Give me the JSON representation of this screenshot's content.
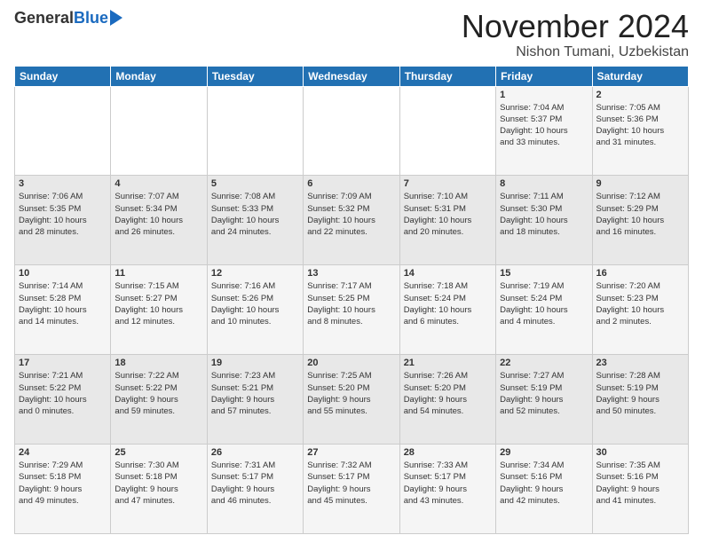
{
  "header": {
    "logo_general": "General",
    "logo_blue": "Blue",
    "month": "November 2024",
    "location": "Nishon Tumani, Uzbekistan"
  },
  "weekdays": [
    "Sunday",
    "Monday",
    "Tuesday",
    "Wednesday",
    "Thursday",
    "Friday",
    "Saturday"
  ],
  "weeks": [
    [
      {
        "day": "",
        "info": ""
      },
      {
        "day": "",
        "info": ""
      },
      {
        "day": "",
        "info": ""
      },
      {
        "day": "",
        "info": ""
      },
      {
        "day": "",
        "info": ""
      },
      {
        "day": "1",
        "info": "Sunrise: 7:04 AM\nSunset: 5:37 PM\nDaylight: 10 hours\nand 33 minutes."
      },
      {
        "day": "2",
        "info": "Sunrise: 7:05 AM\nSunset: 5:36 PM\nDaylight: 10 hours\nand 31 minutes."
      }
    ],
    [
      {
        "day": "3",
        "info": "Sunrise: 7:06 AM\nSunset: 5:35 PM\nDaylight: 10 hours\nand 28 minutes."
      },
      {
        "day": "4",
        "info": "Sunrise: 7:07 AM\nSunset: 5:34 PM\nDaylight: 10 hours\nand 26 minutes."
      },
      {
        "day": "5",
        "info": "Sunrise: 7:08 AM\nSunset: 5:33 PM\nDaylight: 10 hours\nand 24 minutes."
      },
      {
        "day": "6",
        "info": "Sunrise: 7:09 AM\nSunset: 5:32 PM\nDaylight: 10 hours\nand 22 minutes."
      },
      {
        "day": "7",
        "info": "Sunrise: 7:10 AM\nSunset: 5:31 PM\nDaylight: 10 hours\nand 20 minutes."
      },
      {
        "day": "8",
        "info": "Sunrise: 7:11 AM\nSunset: 5:30 PM\nDaylight: 10 hours\nand 18 minutes."
      },
      {
        "day": "9",
        "info": "Sunrise: 7:12 AM\nSunset: 5:29 PM\nDaylight: 10 hours\nand 16 minutes."
      }
    ],
    [
      {
        "day": "10",
        "info": "Sunrise: 7:14 AM\nSunset: 5:28 PM\nDaylight: 10 hours\nand 14 minutes."
      },
      {
        "day": "11",
        "info": "Sunrise: 7:15 AM\nSunset: 5:27 PM\nDaylight: 10 hours\nand 12 minutes."
      },
      {
        "day": "12",
        "info": "Sunrise: 7:16 AM\nSunset: 5:26 PM\nDaylight: 10 hours\nand 10 minutes."
      },
      {
        "day": "13",
        "info": "Sunrise: 7:17 AM\nSunset: 5:25 PM\nDaylight: 10 hours\nand 8 minutes."
      },
      {
        "day": "14",
        "info": "Sunrise: 7:18 AM\nSunset: 5:24 PM\nDaylight: 10 hours\nand 6 minutes."
      },
      {
        "day": "15",
        "info": "Sunrise: 7:19 AM\nSunset: 5:24 PM\nDaylight: 10 hours\nand 4 minutes."
      },
      {
        "day": "16",
        "info": "Sunrise: 7:20 AM\nSunset: 5:23 PM\nDaylight: 10 hours\nand 2 minutes."
      }
    ],
    [
      {
        "day": "17",
        "info": "Sunrise: 7:21 AM\nSunset: 5:22 PM\nDaylight: 10 hours\nand 0 minutes."
      },
      {
        "day": "18",
        "info": "Sunrise: 7:22 AM\nSunset: 5:22 PM\nDaylight: 9 hours\nand 59 minutes."
      },
      {
        "day": "19",
        "info": "Sunrise: 7:23 AM\nSunset: 5:21 PM\nDaylight: 9 hours\nand 57 minutes."
      },
      {
        "day": "20",
        "info": "Sunrise: 7:25 AM\nSunset: 5:20 PM\nDaylight: 9 hours\nand 55 minutes."
      },
      {
        "day": "21",
        "info": "Sunrise: 7:26 AM\nSunset: 5:20 PM\nDaylight: 9 hours\nand 54 minutes."
      },
      {
        "day": "22",
        "info": "Sunrise: 7:27 AM\nSunset: 5:19 PM\nDaylight: 9 hours\nand 52 minutes."
      },
      {
        "day": "23",
        "info": "Sunrise: 7:28 AM\nSunset: 5:19 PM\nDaylight: 9 hours\nand 50 minutes."
      }
    ],
    [
      {
        "day": "24",
        "info": "Sunrise: 7:29 AM\nSunset: 5:18 PM\nDaylight: 9 hours\nand 49 minutes."
      },
      {
        "day": "25",
        "info": "Sunrise: 7:30 AM\nSunset: 5:18 PM\nDaylight: 9 hours\nand 47 minutes."
      },
      {
        "day": "26",
        "info": "Sunrise: 7:31 AM\nSunset: 5:17 PM\nDaylight: 9 hours\nand 46 minutes."
      },
      {
        "day": "27",
        "info": "Sunrise: 7:32 AM\nSunset: 5:17 PM\nDaylight: 9 hours\nand 45 minutes."
      },
      {
        "day": "28",
        "info": "Sunrise: 7:33 AM\nSunset: 5:17 PM\nDaylight: 9 hours\nand 43 minutes."
      },
      {
        "day": "29",
        "info": "Sunrise: 7:34 AM\nSunset: 5:16 PM\nDaylight: 9 hours\nand 42 minutes."
      },
      {
        "day": "30",
        "info": "Sunrise: 7:35 AM\nSunset: 5:16 PM\nDaylight: 9 hours\nand 41 minutes."
      }
    ]
  ]
}
